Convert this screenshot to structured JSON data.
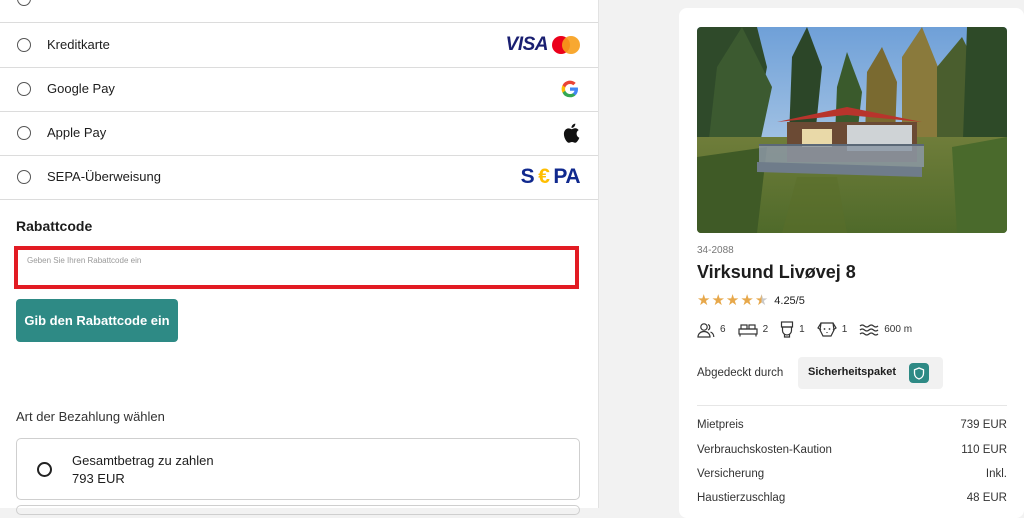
{
  "payment_methods": [
    {
      "label": "Kreditkarte",
      "logo": "visa-mastercard"
    },
    {
      "label": "Google Pay",
      "logo": "google"
    },
    {
      "label": "Apple Pay",
      "logo": "apple"
    },
    {
      "label": "SEPA-Überweisung",
      "logo": "sepa"
    }
  ],
  "logos": {
    "visa": "VISA",
    "google": "G",
    "sepa_s": "S",
    "sepa_e": "€",
    "sepa_pa": "PA"
  },
  "coupon": {
    "title": "Rabattcode",
    "placeholder": "Geben Sie Ihren Rabattcode ein",
    "button_label": "Gib den Rabattcode ein"
  },
  "payment_type": {
    "title": "Art der Bezahlung wählen",
    "option_label": "Gesamtbetrag zu zahlen",
    "option_amount": "793 EUR"
  },
  "property": {
    "code": "34-2088",
    "name": "Virksund Livøvej 8",
    "rating_text": "4.25/5",
    "rating": 4.25,
    "features": [
      {
        "icon": "guests-icon",
        "value": "6"
      },
      {
        "icon": "bed-icon",
        "value": "2"
      },
      {
        "icon": "toilet-icon",
        "value": "1"
      },
      {
        "icon": "pet-icon",
        "value": "1"
      },
      {
        "icon": "water-icon",
        "value": "600 m"
      }
    ],
    "covered_by_label": "Abgedeckt durch",
    "covered_badge": "Sicherheitspaket"
  },
  "prices": [
    {
      "label": "Mietpreis",
      "value": "739 EUR"
    },
    {
      "label": "Verbrauchskosten-Kaution",
      "value": "110 EUR"
    },
    {
      "label": "Versicherung",
      "value": "Inkl."
    },
    {
      "label": "Haustierzuschlag",
      "value": "48 EUR"
    }
  ],
  "colors": {
    "accent": "#2e8a85",
    "highlight": "#e21b23",
    "star": "#e7a84b"
  }
}
